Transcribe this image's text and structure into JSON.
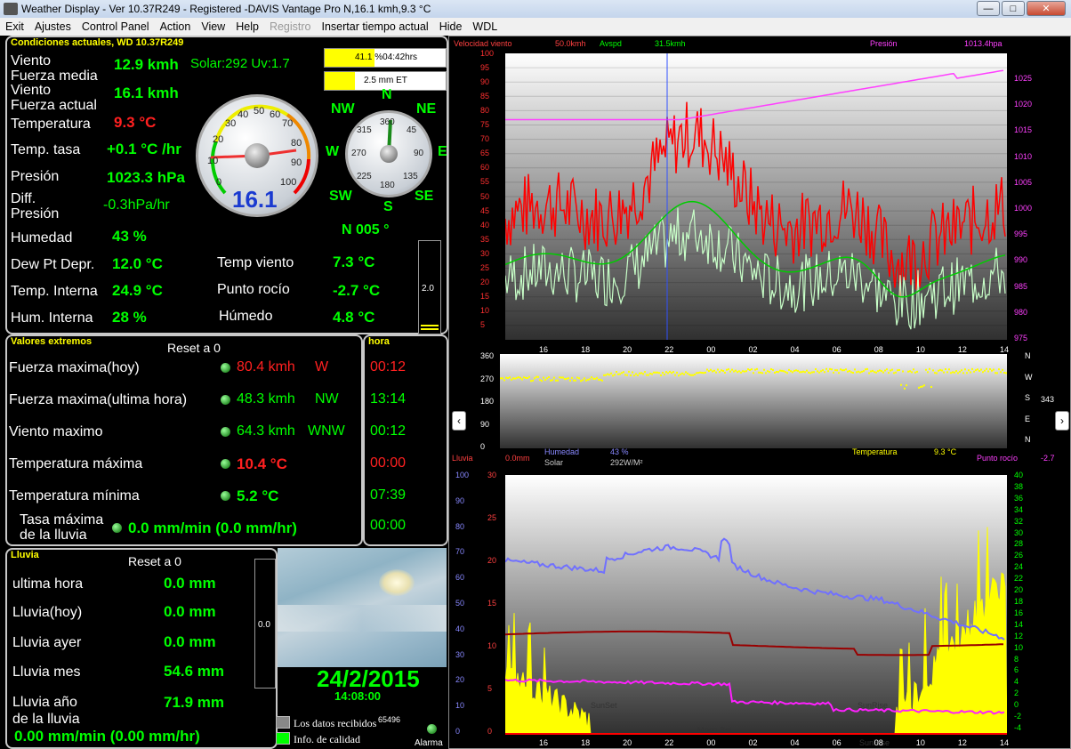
{
  "window": {
    "title": "Weather Display - Ver 10.37R249 - Registered  -DAVIS Vantage Pro   N,16.1 kmh,9.3 °C"
  },
  "menu": [
    "Exit",
    "Ajustes",
    "Control Panel",
    "Action",
    "View",
    "Help",
    "Registro",
    "Insertar tiempo actual",
    "Hide",
    "WDL"
  ],
  "current": {
    "title": "Condiciones actuales, WD 10.37R249",
    "wind_avg_label": "Viento\nFuerza media",
    "wind_avg": "12.9 kmh",
    "solar": "Solar:292 Uv:1.7",
    "wind_now_label": "Viento\nFuerza actual",
    "wind_now": "16.1 kmh",
    "temp_label": "Temperatura",
    "temp": "9.3 °C",
    "temp_rate_label": "Temp. tasa",
    "temp_rate": "+0.1 °C /hr",
    "pressure_label": "Presión",
    "pressure": "1023.3 hPa",
    "diff_label": "Diff.\nPresión",
    "diff": "-0.3hPa/hr",
    "humidity_label": "Humedad",
    "humidity": "43 %",
    "dew_depr_label": "Dew Pt Depr.",
    "dew_depr": "12.0 °C",
    "int_temp_label": "Temp. Interna",
    "int_temp": "24.9 °C",
    "int_hum_label": "Hum. Interna",
    "int_hum": "28 %",
    "wind_chill_label": "Temp viento",
    "wind_chill": "7.3 °C",
    "dew_label": "Punto rocío",
    "dew": "-2.7 °C",
    "humidex_label": "Húmedo",
    "humidex": "4.8 °C",
    "dir": "N  005 °",
    "box1": "41.1 %04:42hrs",
    "box2": "2.5 mm ET",
    "gauge_value": "16.1",
    "gauge_ticks": [
      "0",
      "10",
      "20",
      "30",
      "40",
      "50",
      "60",
      "70",
      "80",
      "90",
      "100"
    ],
    "compass": {
      "N": "N",
      "NE": "NE",
      "E": "E",
      "SE": "SE",
      "S": "S",
      "SW": "SW",
      "W": "W",
      "NW": "NW"
    },
    "compass_ticks": [
      "360",
      "45",
      "90",
      "135",
      "180",
      "225",
      "270",
      "315"
    ],
    "bar_value": "2.0"
  },
  "extremes": {
    "title": "Valores extremos",
    "reset": "Reset a 0",
    "hora_title": "hora",
    "rows": [
      {
        "label": "Fuerza maxima(hoy)",
        "value": "80.4 kmh",
        "dir": "W",
        "time": "00:12",
        "color": "red"
      },
      {
        "label": "Fuerza maxima(ultima hora)",
        "value": "48.3 kmh",
        "dir": "NW",
        "time": "13:14",
        "color": "green"
      },
      {
        "label": "Viento maximo",
        "value": "64.3 kmh",
        "dir": "WNW",
        "time": "00:12",
        "color": "green"
      },
      {
        "label": "Temperatura máxima",
        "value": "10.4 °C",
        "dir": "",
        "time": "00:00",
        "color": "red"
      },
      {
        "label": "Temperatura mínima",
        "value": "5.2 °C",
        "dir": "",
        "time": "07:39",
        "color": "green"
      }
    ],
    "rain_rate_label": "Tasa máxima\nde la lluvia",
    "rain_rate": "0.0 mm/min (0.0 mm/hr)",
    "rain_rate_time": "00:00"
  },
  "rain": {
    "title": "Lluvia",
    "reset": "Reset a 0",
    "rows": [
      {
        "label": "ultima hora",
        "value": "0.0 mm"
      },
      {
        "label": "Lluvia(hoy)",
        "value": "0.0 mm"
      },
      {
        "label": "Lluvia ayer",
        "value": "0.0 mm"
      },
      {
        "label": "Lluvia mes",
        "value": "54.6 mm"
      },
      {
        "label": "Lluvia año\nde la lluvia",
        "value": "71.9 mm"
      }
    ],
    "rate": "0.00 mm/min (0.00 mm/hr)",
    "bar": "0.0"
  },
  "datetime": {
    "date": "24/2/2015",
    "time": "14:08:00"
  },
  "status": {
    "received": "Los datos recibidos",
    "count": "65496",
    "quality": "Info. de calidad",
    "alarm": "Alarma"
  },
  "graph1": {
    "left_label": "Velocidad viento",
    "left_val": "50.0kmh",
    "avspd": "Avspd",
    "avspd_val": "31.5kmh",
    "right_label": "Presión",
    "right_val": "1013.4hpa",
    "y_left": [
      "100",
      "95",
      "90",
      "85",
      "80",
      "75",
      "70",
      "65",
      "60",
      "55",
      "50",
      "45",
      "40",
      "35",
      "30",
      "25",
      "20",
      "15",
      "10",
      "5"
    ],
    "y_right": [
      "1025",
      "1020",
      "1015",
      "1010",
      "1005",
      "1000",
      "995",
      "990",
      "985",
      "980",
      "975"
    ],
    "x": [
      "16",
      "18",
      "20",
      "22",
      "00",
      "02",
      "04",
      "06",
      "08",
      "10",
      "12",
      "14"
    ]
  },
  "graph2": {
    "y": [
      "360",
      "270",
      "180",
      "90",
      "0"
    ],
    "dirs": [
      "N",
      "W",
      "S",
      "E",
      "N"
    ],
    "dir_val": "343"
  },
  "graph3": {
    "lluvia": "Lluvia",
    "lluvia_val": "0.0mm",
    "humedad": "Humedad",
    "humedad_val": "43 %",
    "solar": "Solar",
    "solar_val": "292W/M²",
    "temp": "Temperatura",
    "temp_val": "9.3 °C",
    "dew": "Punto rocío",
    "dew_val": "-2.7",
    "y_left": [
      "100",
      "90",
      "80",
      "70",
      "60",
      "50",
      "40",
      "30",
      "20",
      "10",
      "0"
    ],
    "y_mid": [
      "30",
      "25",
      "20",
      "15",
      "10",
      "5",
      "0"
    ],
    "y_right": [
      "40",
      "38",
      "36",
      "34",
      "32",
      "30",
      "28",
      "26",
      "24",
      "22",
      "20",
      "18",
      "16",
      "14",
      "12",
      "10",
      "8",
      "6",
      "4",
      "2",
      "0",
      "-2",
      "-4"
    ],
    "x": [
      "16",
      "18",
      "20",
      "22",
      "00",
      "02",
      "04",
      "06",
      "08",
      "10",
      "12",
      "14"
    ],
    "sunset": "SunSet",
    "sunrise": "SunRise",
    "moonset": "Moon Set",
    "sunrise2": "SunRise"
  }
}
